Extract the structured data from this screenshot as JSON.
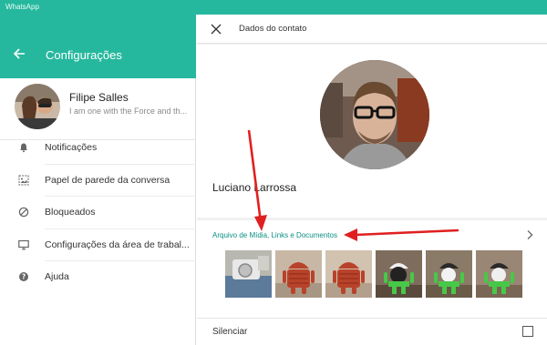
{
  "window": {
    "app_title": "WhatsApp"
  },
  "settings": {
    "title": "Configurações",
    "profile": {
      "name": "Filipe Salles",
      "status": "I am one with the Force and th..."
    },
    "menu": [
      {
        "label": "Notificações",
        "icon": "bell-icon"
      },
      {
        "label": "Papel de parede da conversa",
        "icon": "wallpaper-icon"
      },
      {
        "label": "Bloqueados",
        "icon": "blocked-icon"
      },
      {
        "label": "Configurações da área de trabal...",
        "icon": "desktop-icon"
      },
      {
        "label": "Ajuda",
        "icon": "help-icon"
      }
    ]
  },
  "contact": {
    "header_title": "Dados do contato",
    "name": "Luciano Larrossa",
    "media_link": "Arquivo de Mídia, Links e Documentos",
    "mute_label": "Silenciar",
    "mute_checked": false,
    "thumbnails": [
      "photo-thumbnail",
      "android-figurine-thumbnail",
      "android-figurine-thumbnail",
      "android-figurine-thumbnail",
      "android-figurine-thumbnail",
      "android-figurine-thumbnail"
    ]
  },
  "colors": {
    "accent": "#26b89e",
    "link": "#0a8f80",
    "annotation": "#e02020"
  }
}
